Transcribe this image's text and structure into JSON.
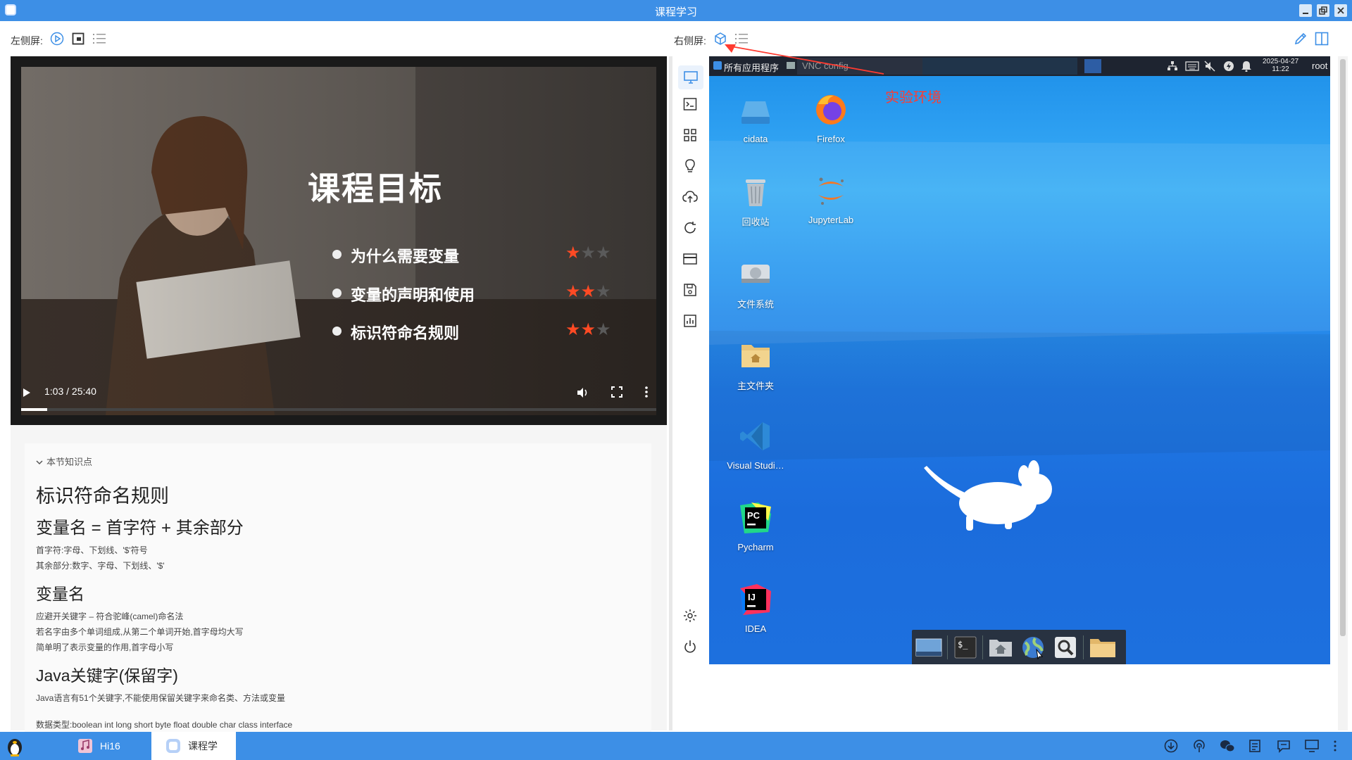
{
  "window": {
    "title": "课程学习",
    "icon": "app-icon",
    "controls": [
      "minimize-icon",
      "restore-icon",
      "close-icon"
    ]
  },
  "toolbar": {
    "left_label": "左侧屏:",
    "right_label": "右侧屏:",
    "left_icons": [
      "play-circle-icon",
      "browser-icon",
      "list-icon"
    ],
    "right_icons": [
      "cube-icon",
      "list-icon"
    ],
    "edit_icon": "pencil-icon",
    "split_icon": "split-view-icon"
  },
  "video": {
    "slide_title": "课程目标",
    "objectives": [
      {
        "text": "为什么需要变量",
        "stars": 1,
        "max": 3
      },
      {
        "text": "变量的声明和使用",
        "stars": 2,
        "max": 3
      },
      {
        "text": "标识符命名规则",
        "stars": 2,
        "max": 3
      }
    ],
    "time": "1:03 / 25:40",
    "progress_fraction": 0.041
  },
  "knowledge": {
    "header": "本节知识点",
    "h1": "标识符命名规则",
    "h2": "变量名 = 首字符 + 其余部分",
    "line1": "首字符:字母、下划线、'$'符号",
    "line2": "其余部分:数字、字母、下划线、'$'",
    "h3a": "变量名",
    "line3": "应避开关键字 – 符合驼峰(camel)命名法",
    "line4": "若名字由多个单词组成,从第二个单词开始,首字母均大写",
    "line5": "简单明了表示变量的作用,首字母小写",
    "h3b": "Java关键字(保留字)",
    "line6": "Java语言有51个关键字,不能使用保留关键字来命名类、方法或变量",
    "line7": "数据类型:boolean int long short byte float double char class interface"
  },
  "rail": {
    "icons": [
      "monitor-icon",
      "terminal-icon",
      "apps-grid-icon",
      "lightbulb-icon",
      "cloud-upload-icon",
      "refresh-icon",
      "card-icon",
      "save-icon",
      "chart-icon"
    ],
    "bottom_icons": [
      "settings-icon",
      "power-icon"
    ]
  },
  "desktop": {
    "panel_menu": "所有应用程序",
    "panel_window": "VNC config",
    "date": "2025-04-27",
    "time": "11:22",
    "user": "root",
    "annotation": "实验环境",
    "icons": [
      {
        "label": "cidata",
        "icon": "drive-icon"
      },
      {
        "label": "Firefox",
        "icon": "firefox-icon"
      },
      {
        "label": "回收站",
        "icon": "trash-icon"
      },
      {
        "label": "JupyterLab",
        "icon": "jupyter-icon"
      },
      {
        "label": "文件系统",
        "icon": "harddisk-icon"
      },
      {
        "label": "主文件夹",
        "icon": "home-folder-icon"
      },
      {
        "label": "Visual Studi…",
        "icon": "vscode-icon"
      },
      {
        "label": "Pycharm",
        "icon": "pycharm-icon"
      },
      {
        "label": "IDEA",
        "icon": "idea-icon"
      }
    ],
    "dock": [
      "show-desktop-icon",
      "terminal-icon",
      "home-folder-icon",
      "web-browser-icon",
      "search-icon",
      "folder-icon"
    ]
  },
  "taskbar": {
    "start_icon": "penguin-icon",
    "tasks": [
      {
        "label": "Hi16",
        "icon": "music-icon"
      },
      {
        "label": "课程学",
        "icon": "app-icon"
      }
    ],
    "tray": [
      "download-icon",
      "hotspot-icon",
      "wechat-icon",
      "reader-icon",
      "chat-icon",
      "display-icon",
      "more-icon"
    ]
  },
  "colors": {
    "accent": "#3d8fe6",
    "star_on": "#ff4a24",
    "annotation": "#ff3b30"
  }
}
